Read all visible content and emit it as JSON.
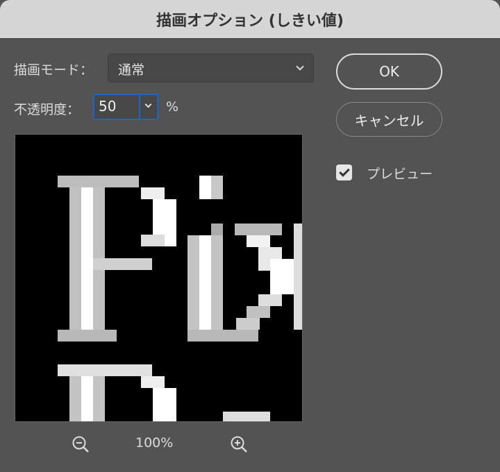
{
  "dialog": {
    "title": "描画オプション (しきい値)"
  },
  "mode": {
    "label": "描画モード：",
    "value": "通常"
  },
  "opacity": {
    "label": "不透明度：",
    "value": "50",
    "unit": "%"
  },
  "buttons": {
    "ok": "OK",
    "cancel": "キャンセル"
  },
  "preview_toggle": {
    "label": "プレビュー",
    "checked": true
  },
  "zoom": {
    "level": "100%"
  },
  "icons": [
    "zoom-out-icon",
    "zoom-in-icon",
    "chevron-down-icon",
    "checkmark-icon"
  ]
}
